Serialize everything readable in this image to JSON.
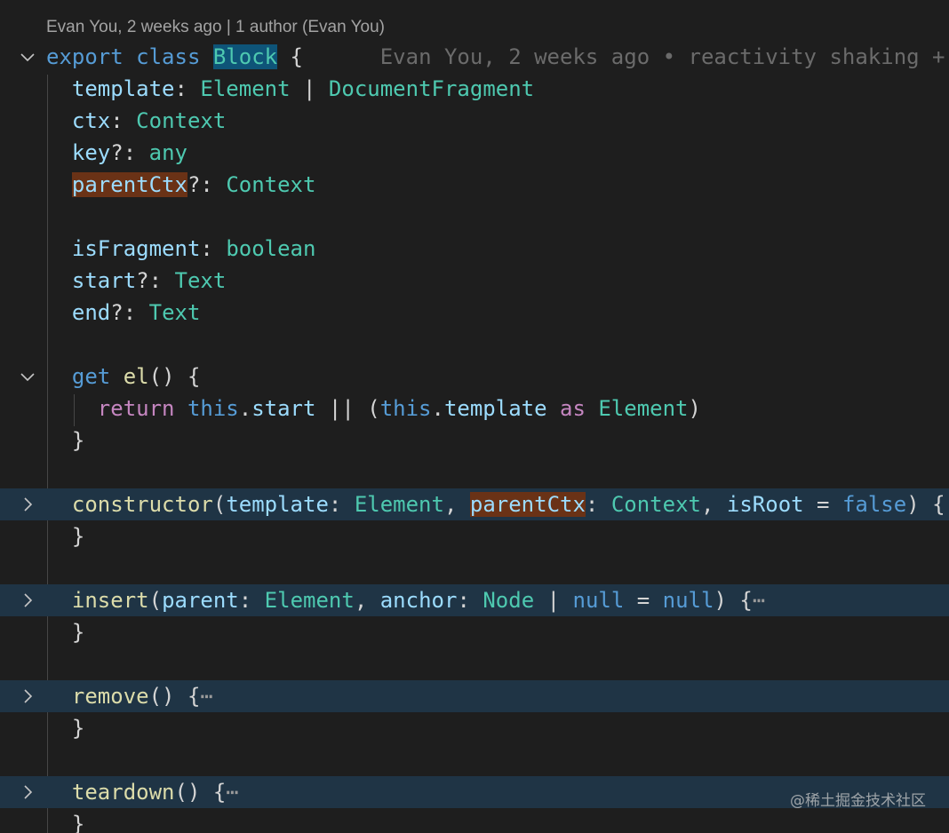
{
  "codelens": "Evan You, 2 weeks ago | 1 author (Evan You)",
  "blame": "Evan You, 2 weeks ago • reactivity shaking +",
  "watermark": "@稀土掘金技术社区",
  "lines": {
    "l1": {
      "export": "export",
      "class": "class",
      "name": "Block",
      "brace": " {"
    },
    "l2": {
      "prop": "template",
      "colon": ": ",
      "t1": "Element",
      "pipe": " | ",
      "t2": "DocumentFragment"
    },
    "l3": {
      "prop": "ctx",
      "colon": ": ",
      "t1": "Context"
    },
    "l4": {
      "prop": "key",
      "colon": "?: ",
      "t1": "any"
    },
    "l5": {
      "prop": "parentCtx",
      "colon": "?: ",
      "t1": "Context"
    },
    "l7": {
      "prop": "isFragment",
      "colon": ": ",
      "t1": "boolean"
    },
    "l8": {
      "prop": "start",
      "colon": "?: ",
      "t1": "Text"
    },
    "l9": {
      "prop": "end",
      "colon": "?: ",
      "t1": "Text"
    },
    "l11": {
      "get": "get",
      "name": "el",
      "rest": "() {"
    },
    "l12": {
      "ret": "return",
      "this1": "this",
      "dot1": ".",
      "start": "start",
      "or": " || (",
      "this2": "this",
      "dot2": ".",
      "tmpl": "template",
      "as": "as",
      "el": "Element",
      "close": ")"
    },
    "l13": {
      "brace": "}"
    },
    "l15": {
      "name": "constructor",
      "p1": "(",
      "a1": "template",
      "c1": ": ",
      "t1": "Element",
      "comma1": ", ",
      "a2": "parentCtx",
      "c2": ": ",
      "t2": "Context",
      "comma2": ", ",
      "a3": "isRoot",
      "eq": " = ",
      "val": "false",
      "end": ") {"
    },
    "l16": {
      "brace": "}"
    },
    "l18": {
      "name": "insert",
      "p1": "(",
      "a1": "parent",
      "c1": ": ",
      "t1": "Element",
      "comma1": ", ",
      "a2": "anchor",
      "c2": ": ",
      "t2": "Node",
      "pipe": " | ",
      "n1": "null",
      "eq": " = ",
      "n2": "null",
      "end": ") {",
      "dots": "⋯"
    },
    "l19": {
      "brace": "}"
    },
    "l21": {
      "name": "remove",
      "rest": "() {",
      "dots": "⋯"
    },
    "l22": {
      "brace": "}"
    },
    "l24": {
      "name": "teardown",
      "rest": "() {",
      "dots": "⋯"
    },
    "l25": {
      "brace": "}"
    }
  },
  "icons": {
    "expanded": "chevron-down-icon",
    "collapsed": "chevron-right-icon"
  },
  "colors": {
    "background": "#1e1e1e",
    "keyword": "#569cd6",
    "control": "#c586c0",
    "type": "#4ec9b0",
    "property": "#9cdcfe",
    "function": "#dcdcaa",
    "folded_line_bg": "#1f3445",
    "symbol_highlight": "#0e5478",
    "occurrence_highlight": "#6a3216"
  }
}
